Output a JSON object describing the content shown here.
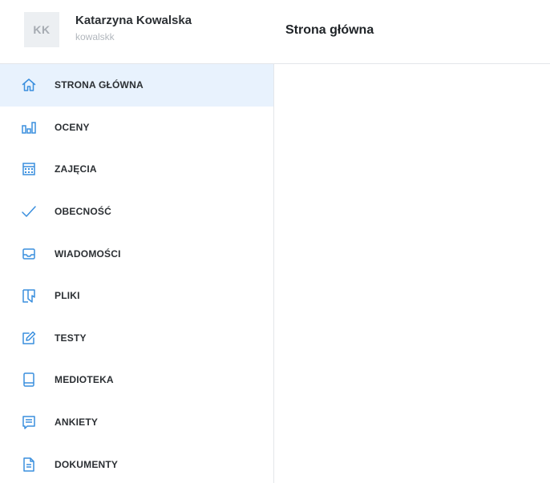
{
  "user": {
    "initials": "KK",
    "name": "Katarzyna Kowalska",
    "login": "kowalskk"
  },
  "page": {
    "title": "Strona główna"
  },
  "colors": {
    "accent": "#3a8fde",
    "active_bg": "#e8f2fd",
    "text": "#2b2f33",
    "muted": "#b2b7bd"
  },
  "sidebar": {
    "items": [
      {
        "label": "STRONA GŁÓWNA",
        "icon": "home-icon",
        "active": true
      },
      {
        "label": "OCENY",
        "icon": "bar-chart-icon",
        "active": false
      },
      {
        "label": "ZAJĘCIA",
        "icon": "calendar-icon",
        "active": false
      },
      {
        "label": "OBECNOŚĆ",
        "icon": "checkmark-icon",
        "active": false
      },
      {
        "label": "WIADOMOŚCI",
        "icon": "inbox-icon",
        "active": false
      },
      {
        "label": "PLIKI",
        "icon": "folder-icon",
        "active": false
      },
      {
        "label": "TESTY",
        "icon": "edit-icon",
        "active": false
      },
      {
        "label": "MEDIOTEKA",
        "icon": "tablet-icon",
        "active": false
      },
      {
        "label": "ANKIETY",
        "icon": "survey-icon",
        "active": false
      },
      {
        "label": "DOKUMENTY",
        "icon": "document-icon",
        "active": false
      }
    ]
  }
}
